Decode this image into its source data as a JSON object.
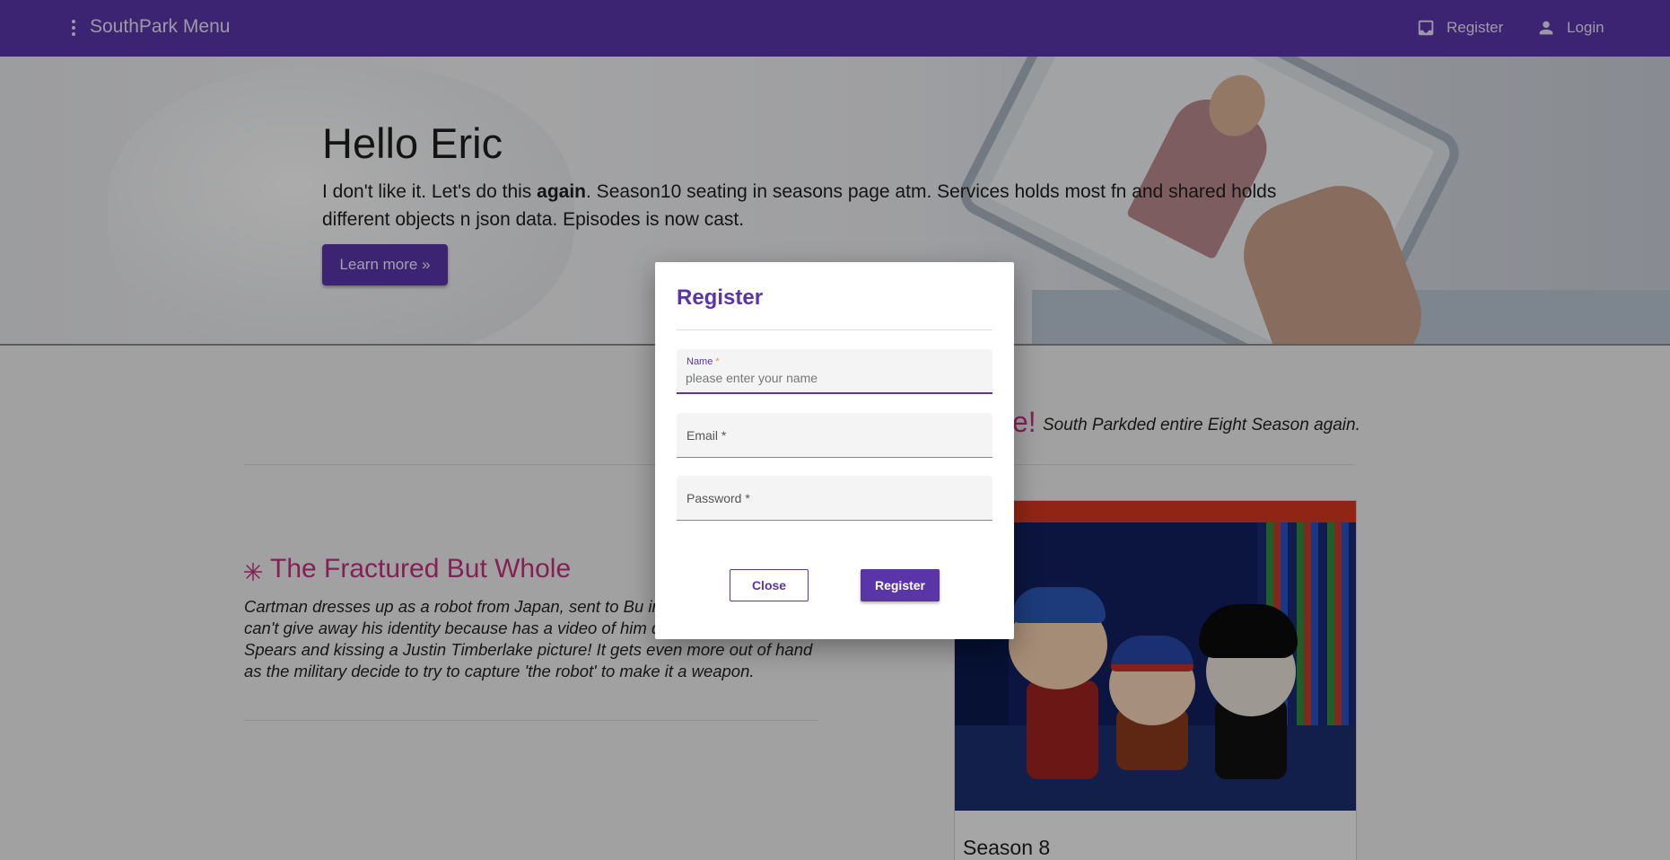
{
  "navbar": {
    "brand": "SouthPark Menu",
    "register_label": "Register",
    "login_label": "Login"
  },
  "hero": {
    "title": "Hello Eric",
    "text_before_bold": "I don't like it. Let's do this ",
    "text_bold": "again",
    "text_after_bold": ". Season10 seating in seasons page atm. Services holds most fn and shared holds different objects n json data. Episodes is now cast.",
    "button_label": "Learn more »"
  },
  "featurette": {
    "heading_fragment": "e!",
    "subheading": "South Parkded entire Eight Season again."
  },
  "episode": {
    "title": "The Fractured But Whole",
    "description": "Cartman dresses up as a robot from Japan, sent to Bu into believing it and can't give away his identity because has a video of him dancing to Britney Spears and kissing a Justin Timberlake picture! It gets even more out of hand as the military decide to try to capture 'the robot' to make it a weapon."
  },
  "season_card": {
    "label": "Season 8"
  },
  "modal": {
    "title": "Register",
    "name_label": "Name",
    "name_required_mark": "*",
    "name_placeholder": "please enter your name",
    "email_label": "Email *",
    "password_label": "Password *",
    "close_label": "Close",
    "register_label": "Register"
  },
  "colors": {
    "primary": "#5a35a8",
    "accent_pink": "#c5307e",
    "required_mark": "#d8a23c"
  },
  "icons": {
    "menu": "more-vert-icon",
    "register": "inbox-icon",
    "login": "person-icon",
    "episode": "sparkle-icon"
  }
}
